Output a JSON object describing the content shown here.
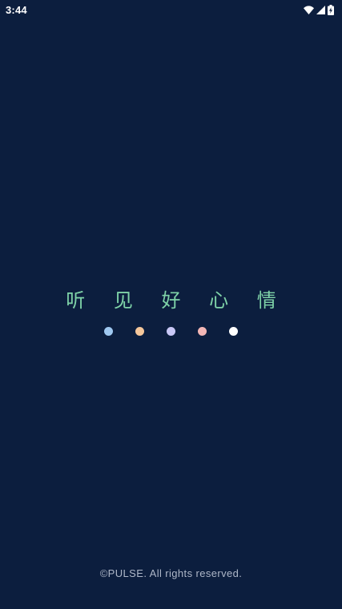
{
  "status_bar": {
    "time": "3:44",
    "icons": [
      "wifi-icon",
      "cellular-signal-icon",
      "battery-charging-icon"
    ]
  },
  "splash": {
    "slogan": "听 见 好 心 情",
    "slogan_color": "#7fd3a8",
    "dot_colors": [
      "#9fc8f0",
      "#f5c79b",
      "#c9c8f6",
      "#f3b7b6",
      "#ffffff"
    ]
  },
  "footer": {
    "copyright": "©PULSE. All rights reserved."
  },
  "theme": {
    "background": "#0c1e3e"
  }
}
